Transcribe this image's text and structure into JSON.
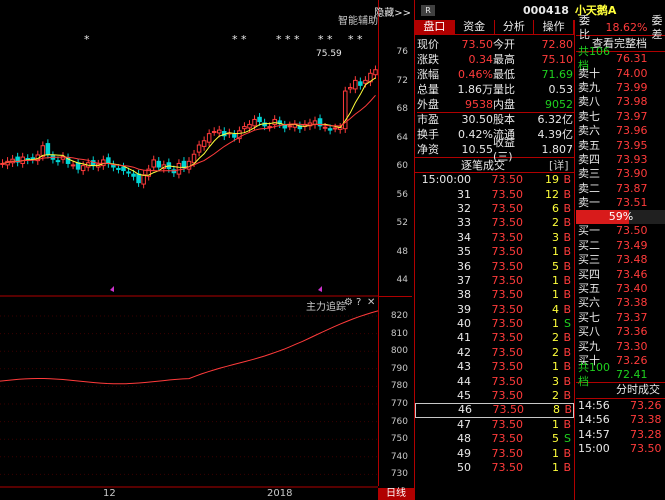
{
  "toolbar": {
    "hide_label": "隐藏>>",
    "assist_label": "智能辅助",
    "rights_badge": "R",
    "stock_code": "000418",
    "stock_name": "小天鹅A"
  },
  "stars": [
    "*",
    "* *",
    "* * *",
    "* *",
    "* *"
  ],
  "price_chart": {
    "max_label": "75.59",
    "y_ticks": [
      "76",
      "72",
      "68",
      "64",
      "60",
      "56",
      "52",
      "48",
      "44"
    ]
  },
  "indicator": {
    "title": "主力追踪",
    "y_ticks": [
      "820",
      "810",
      "800",
      "790",
      "780",
      "770",
      "760",
      "750",
      "740",
      "730"
    ]
  },
  "x_axis": {
    "labels": [
      "12",
      "2018"
    ],
    "period_button": "日线"
  },
  "panel": {
    "tabs": [
      "盘口",
      "资金",
      "分析",
      "操作"
    ],
    "quote": [
      {
        "l1": "现价",
        "v1": "73.50",
        "l2": "今开",
        "v2": "72.80"
      },
      {
        "l1": "涨跌",
        "v1": "0.34",
        "l2": "最高",
        "v2": "75.10"
      },
      {
        "l1": "涨幅",
        "v1": "0.46%",
        "l2": "最低",
        "v2": "71.69"
      },
      {
        "l1": "总量",
        "v1": "1.86万",
        "l2": "量比",
        "v2": "0.53"
      },
      {
        "l1": "外盘",
        "v1": "9538",
        "l2": "内盘",
        "v2": "9052"
      },
      {
        "l1": "市盈",
        "v1": "30.50",
        "l2": "股本",
        "v2": "6.32亿"
      },
      {
        "l1": "换手",
        "v1": "0.42%",
        "l2": "流通",
        "v2": "4.39亿"
      },
      {
        "l1": "净资",
        "v1": "10.55",
        "l2": "收益(三)",
        "v2": "1.807"
      }
    ],
    "ticks_header": "逐笔成交",
    "ticks_detail": "[详]",
    "ticks": [
      {
        "t": "15:00:00",
        "p": "73.50",
        "v": "19",
        "d": "B"
      },
      {
        "t": "31",
        "p": "73.50",
        "v": "12",
        "d": "B"
      },
      {
        "t": "32",
        "p": "73.50",
        "v": "6",
        "d": "B"
      },
      {
        "t": "33",
        "p": "73.50",
        "v": "2",
        "d": "B"
      },
      {
        "t": "34",
        "p": "73.50",
        "v": "3",
        "d": "B"
      },
      {
        "t": "35",
        "p": "73.50",
        "v": "1",
        "d": "B"
      },
      {
        "t": "36",
        "p": "73.50",
        "v": "5",
        "d": "B"
      },
      {
        "t": "37",
        "p": "73.50",
        "v": "1",
        "d": "B"
      },
      {
        "t": "38",
        "p": "73.50",
        "v": "1",
        "d": "B"
      },
      {
        "t": "39",
        "p": "73.50",
        "v": "4",
        "d": "B"
      },
      {
        "t": "40",
        "p": "73.50",
        "v": "1",
        "d": "S"
      },
      {
        "t": "41",
        "p": "73.50",
        "v": "2",
        "d": "B"
      },
      {
        "t": "42",
        "p": "73.50",
        "v": "2",
        "d": "B"
      },
      {
        "t": "43",
        "p": "73.50",
        "v": "1",
        "d": "B"
      },
      {
        "t": "44",
        "p": "73.50",
        "v": "3",
        "d": "B"
      },
      {
        "t": "45",
        "p": "73.50",
        "v": "2",
        "d": "B"
      },
      {
        "t": "46",
        "p": "73.50",
        "v": "8",
        "d": "B"
      },
      {
        "t": "47",
        "p": "73.50",
        "v": "1",
        "d": "B"
      },
      {
        "t": "48",
        "p": "73.50",
        "v": "5",
        "d": "S"
      },
      {
        "t": "49",
        "p": "73.50",
        "v": "1",
        "d": "B"
      },
      {
        "t": "50",
        "p": "73.50",
        "v": "1",
        "d": "B"
      }
    ],
    "book": {
      "ratio_label": "委比",
      "ratio_value": "18.62%",
      "ratio_extra": "委差",
      "full_button": "查看完整档",
      "sell_total_label": "共106档",
      "sell_total_price": "76.31",
      "sells": [
        {
          "l": "卖十",
          "p": "74.00"
        },
        {
          "l": "卖九",
          "p": "73.99"
        },
        {
          "l": "卖八",
          "p": "73.98"
        },
        {
          "l": "卖七",
          "p": "73.97"
        },
        {
          "l": "卖六",
          "p": "73.96"
        },
        {
          "l": "卖五",
          "p": "73.95"
        },
        {
          "l": "卖四",
          "p": "73.93"
        },
        {
          "l": "卖三",
          "p": "73.90"
        },
        {
          "l": "卖二",
          "p": "73.87"
        },
        {
          "l": "卖一",
          "p": "73.51"
        }
      ],
      "split_label": "59%",
      "split_fraction": 0.59,
      "buys": [
        {
          "l": "买一",
          "p": "73.50"
        },
        {
          "l": "买二",
          "p": "73.49"
        },
        {
          "l": "买三",
          "p": "73.48"
        },
        {
          "l": "买四",
          "p": "73.46"
        },
        {
          "l": "买五",
          "p": "73.40"
        },
        {
          "l": "买六",
          "p": "73.38"
        },
        {
          "l": "买七",
          "p": "73.37"
        },
        {
          "l": "买八",
          "p": "73.36"
        },
        {
          "l": "买九",
          "p": "73.30"
        },
        {
          "l": "买十",
          "p": "73.26"
        }
      ],
      "buy_total_label": "共100档",
      "buy_total_price": "72.41",
      "minute_header": "分时成交",
      "minute": [
        {
          "t": "14:56",
          "p": "73.26"
        },
        {
          "t": "14:56",
          "p": "73.38"
        },
        {
          "t": "14:57",
          "p": "73.28"
        },
        {
          "t": "15:00",
          "p": "73.50"
        }
      ]
    }
  },
  "colors": {
    "up": "#ff3b3b",
    "down": "#1fd11f",
    "accent": "#b00000",
    "ma5": "#ffff3b",
    "ma10": "#ff3b3b",
    "teal": "#00d4d4"
  }
}
